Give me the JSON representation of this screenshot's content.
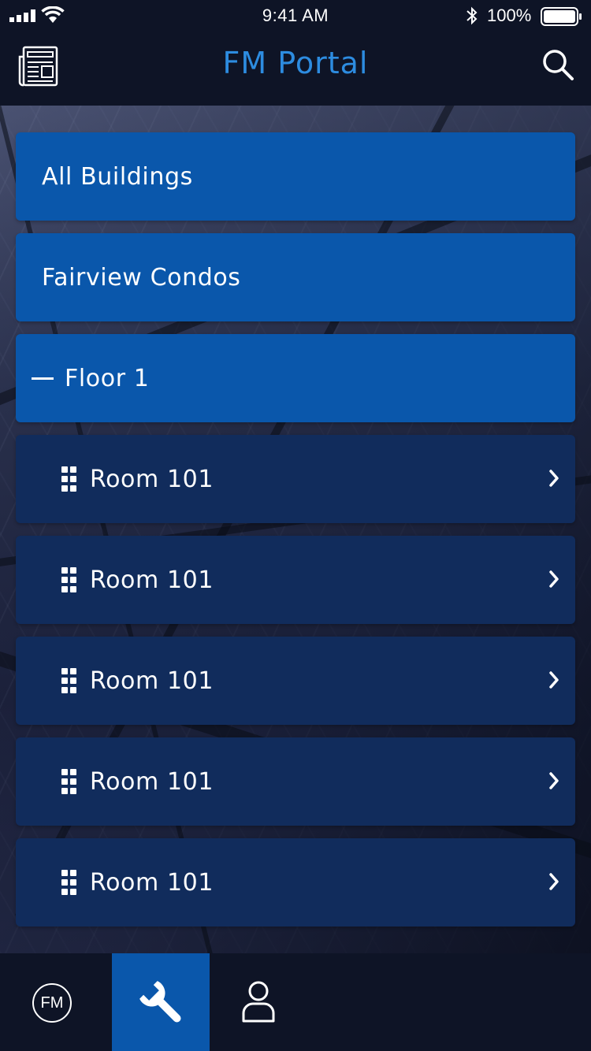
{
  "status_bar": {
    "time": "9:41 AM",
    "battery": "100%"
  },
  "header": {
    "title": "FM Portal",
    "left_icon": "newspaper-icon",
    "right_icon": "search-icon"
  },
  "list": {
    "items": [
      {
        "label": "All Buildings",
        "kind": "primary"
      },
      {
        "label": "Fairview Condos",
        "kind": "primary"
      },
      {
        "label": "Floor 1",
        "kind": "floor",
        "icon": "collapse-dash-icon"
      },
      {
        "label": "Room 101",
        "kind": "room",
        "icon": "grid-dots-icon"
      },
      {
        "label": "Room 101",
        "kind": "room",
        "icon": "grid-dots-icon"
      },
      {
        "label": "Room 101",
        "kind": "room",
        "icon": "grid-dots-icon"
      },
      {
        "label": "Room 101",
        "kind": "room",
        "icon": "grid-dots-icon"
      },
      {
        "label": "Room 101",
        "kind": "room",
        "icon": "grid-dots-icon"
      }
    ]
  },
  "tabbar": {
    "fm_label": "FM",
    "tabs": [
      "fm-logo-icon",
      "wrench-icon",
      "user-icon"
    ],
    "active_tab": "wrench-icon"
  },
  "colors": {
    "accent": "#0a57ab",
    "title": "#2d8ce0",
    "room_row": "#112c5c",
    "background": "#0e1426"
  }
}
